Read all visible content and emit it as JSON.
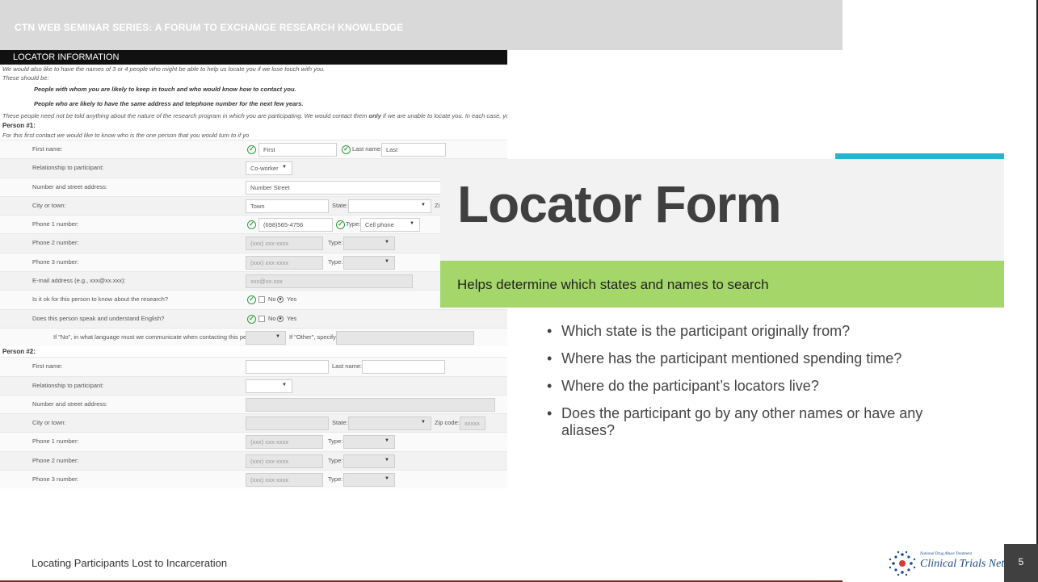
{
  "header": {
    "series_title": "CTN WEB SEMINAR SERIES: A FORUM TO EXCHANGE RESEARCH KNOWLEDGE"
  },
  "form": {
    "title": "LOCATOR INFORMATION",
    "intro": "We would also like to have the names of 3 or 4 people who might be able to help us locate you if we lose touch with you.",
    "should_be": "These should be:",
    "criteria": [
      "People with whom you are likely to keep in touch and who would know how to contact you.",
      "People who are likely to have the same address and telephone number for the next few years."
    ],
    "note_pre": "These people need not be told anything about the nature of the research program in which you are participating. We would contact them ",
    "note_bold": "only",
    "note_post": " if we are unable to locate you. In each case, you can indicate",
    "person1": {
      "heading": "Person #1:",
      "intro": "For this first contact we would like to know who is the one person that you would turn to if yo",
      "labels": {
        "first_name": "First name:",
        "relationship": "Relationship to participant:",
        "street": "Number and street address:",
        "city": "City or town:",
        "phone1": "Phone 1 number:",
        "phone2": "Phone 2 number:",
        "phone3": "Phone 3 number:",
        "email": "E-mail address (e.g., xxx@xx.xxx):",
        "ok_know": "Is it ok for this person to know about the research?",
        "speak_english": "Does this person speak and understand English?",
        "language": "If \"No\", in what language must we communicate when contacting this person?"
      },
      "first_name_value": "First",
      "last_name_label": "Last name:",
      "last_name_value": "Last",
      "relationship_value": "Co-worker",
      "street_value": "Number Street",
      "city_value": "Town",
      "state_label": "State:",
      "zip_label_partial": "Zi",
      "phone1_value": "(698)565-4756",
      "type_label": "Type:",
      "phone1_type": "Cell phone",
      "phone_placeholder": "(xxx) xxx-xxxx",
      "email_placeholder": "xxx@xx.xxx",
      "no_label": "No",
      "yes_label": "Yes",
      "other_label": "If \"Other\", specify:"
    },
    "person2": {
      "heading": "Person #2:",
      "labels": {
        "first_name": "First name:",
        "relationship": "Relationship to participant:",
        "street": "Number and street address:",
        "city": "City or town:",
        "phone1": "Phone 1 number:",
        "phone2": "Phone 2 number:",
        "phone3": "Phone 3 number:"
      },
      "last_name_label": "Last name:",
      "state_label": "State:",
      "zip_label": "Zip code:",
      "zip_placeholder": "xxxxx",
      "type_label": "Type:",
      "phone_placeholder": "(xxx) xxx-xxxx"
    }
  },
  "slide": {
    "title": "Locator Form",
    "subtitle": "Helps determine which states and names to search",
    "bullets": [
      "Which state is the participant originally from?",
      "Where has the participant mentioned spending time?",
      "Where do the participant’s locators live?",
      "Does the participant go by any other names or have any aliases?"
    ]
  },
  "footer": {
    "text": "Locating Participants Lost to Incarceration",
    "logo_small": "National Drug Abuse Treatment",
    "logo_big": "Clinical Trials Network",
    "page_number": "5"
  },
  "colors": {
    "accent_green": "#a5d66a",
    "accent_cyan": "#1fb7d4",
    "check_green": "#2e9e3e",
    "dark_gray": "#404040"
  },
  "icons": {
    "field_valid": "check-circle-icon",
    "dropdown": "chevron-down-icon",
    "logo": "ctn-logo-icon"
  }
}
